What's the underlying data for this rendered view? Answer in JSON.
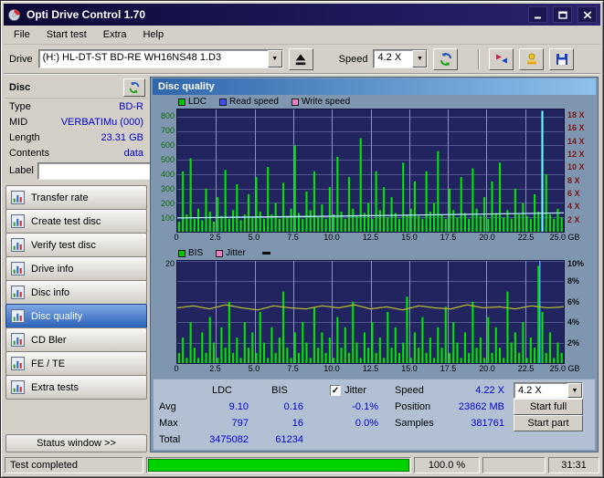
{
  "window": {
    "title": "Opti Drive Control 1.70"
  },
  "menu": {
    "items": [
      "File",
      "Start test",
      "Extra",
      "Help"
    ]
  },
  "toolbar": {
    "drive_label": "Drive",
    "drive_value": "(H:)  HL-DT-ST BD-RE  WH16NS48 1.D3",
    "speed_label": "Speed",
    "speed_value": "4.2 X"
  },
  "sidebar": {
    "header": "Disc",
    "info": [
      {
        "label": "Type",
        "value": "BD-R"
      },
      {
        "label": "MID",
        "value": "VERBATIMu (000)"
      },
      {
        "label": "Length",
        "value": "23.31 GB"
      },
      {
        "label": "Contents",
        "value": "data"
      }
    ],
    "label_field": {
      "label": "Label",
      "value": ""
    },
    "buttons": [
      {
        "label": "Transfer rate"
      },
      {
        "label": "Create test disc"
      },
      {
        "label": "Verify test disc"
      },
      {
        "label": "Drive info"
      },
      {
        "label": "Disc info"
      },
      {
        "label": "Disc quality",
        "active": true
      },
      {
        "label": "CD Bler"
      },
      {
        "label": "FE / TE"
      },
      {
        "label": "Extra tests"
      }
    ],
    "status_window_label": "Status window >>"
  },
  "panel": {
    "title": "Disc quality"
  },
  "chart_data": [
    {
      "type": "bar",
      "title": "Disc quality - LDC / Read speed",
      "legend": [
        {
          "label": "LDC",
          "color": "#00c400"
        },
        {
          "label": "Read speed",
          "color": "#3c50ff"
        },
        {
          "label": "Write speed",
          "color": "#f080c0"
        }
      ],
      "x_ticks": [
        "0",
        "2.5",
        "5.0",
        "7.5",
        "10.0",
        "12.5",
        "15.0",
        "17.5",
        "20.0",
        "22.5",
        "25.0 GB"
      ],
      "xlabel_unit": "GB",
      "y_left": {
        "ticks": [
          800,
          700,
          600,
          500,
          400,
          300,
          200,
          100
        ],
        "max": 850
      },
      "y_right": {
        "labels": [
          "18 X",
          "16 X",
          "14 X",
          "12 X",
          "10 X",
          "8 X",
          "6 X",
          "4 X",
          "2 X"
        ],
        "max": 19
      },
      "grid_h": [
        100,
        200,
        300,
        400,
        500,
        600,
        700,
        800
      ],
      "bar_color": "#00e400",
      "bars": [
        70,
        420,
        120,
        510,
        90,
        160,
        80,
        300,
        140,
        70,
        240,
        110,
        430,
        90,
        150,
        330,
        80,
        120,
        260,
        100,
        380,
        140,
        90,
        450,
        120,
        200,
        90,
        340,
        110,
        160,
        600,
        130,
        90,
        280,
        150,
        420,
        100,
        190,
        90,
        310,
        120,
        520,
        140,
        90,
        380,
        160,
        110,
        650,
        130,
        200,
        90,
        420,
        150,
        310,
        100,
        240,
        130,
        90,
        480,
        120,
        160,
        350,
        110,
        90,
        420,
        140,
        200,
        560,
        120,
        90,
        300,
        150,
        100,
        380,
        130,
        90,
        440,
        160,
        110,
        240,
        90,
        350,
        130,
        480,
        100,
        150,
        90,
        300,
        120,
        200,
        110,
        90,
        260,
        140,
        840,
        400,
        120,
        90,
        160,
        100
      ],
      "highlight": {
        "index": 94,
        "color": "#66ffff"
      },
      "line": {
        "name": "Read speed",
        "color": "#b8e8ff",
        "max": 850,
        "values": [
          96,
          99,
          102,
          105,
          108,
          112,
          115,
          119,
          123,
          127,
          131
        ]
      }
    },
    {
      "type": "bar",
      "title": "Disc quality - BIS / Jitter",
      "legend": [
        {
          "label": "BIS",
          "color": "#00c400"
        },
        {
          "label": "Jitter",
          "color": "#f080c0"
        }
      ],
      "x_ticks": [
        "0",
        "2.5",
        "5.0",
        "7.5",
        "10.0",
        "12.5",
        "15.0",
        "17.5",
        "20.0",
        "22.5",
        "25.0 GB"
      ],
      "y_left": {
        "ticks": [
          20
        ],
        "max": 20
      },
      "y_right": {
        "labels": [
          "10%",
          "8%",
          "6%",
          "4%",
          "2%"
        ],
        "max": 10
      },
      "grid_h": [
        4,
        8,
        12,
        16,
        20
      ],
      "bar_color": "#00e400",
      "bars": [
        2,
        5,
        1,
        8,
        3,
        1,
        6,
        2,
        9,
        4,
        1,
        7,
        3,
        12,
        2,
        5,
        1,
        8,
        3,
        6,
        2,
        10,
        4,
        1,
        7,
        2,
        5,
        14,
        3,
        1,
        6,
        2,
        8,
        4,
        1,
        11,
        3,
        6,
        2,
        5,
        1,
        9,
        3,
        7,
        2,
        12,
        4,
        1,
        6,
        3,
        8,
        2,
        5,
        1,
        10,
        3,
        7,
        2,
        4,
        13,
        1,
        6,
        3,
        9,
        2,
        5,
        1,
        7,
        3,
        11,
        2,
        8,
        4,
        1,
        6,
        2,
        12,
        3,
        5,
        1,
        9,
        2,
        7,
        3,
        1,
        14,
        4,
        6,
        2,
        8,
        1,
        5,
        3,
        19,
        10,
        2,
        6,
        1,
        4,
        2
      ],
      "vline": {
        "frac": 0.938,
        "color": "#4aa0ff"
      },
      "line": {
        "name": "Jitter",
        "color": "#b8b835",
        "max": 10,
        "values": [
          5.4,
          5.6,
          5.3,
          5.7,
          5.4,
          5.2,
          5.6,
          5.4,
          5.3,
          5.6,
          5.4,
          5.7,
          5.3,
          5.5,
          5.2,
          5.6,
          5.4,
          5.3,
          5.7,
          5.4,
          5.5,
          5.3,
          5.6,
          5.4,
          5.5
        ]
      }
    }
  ],
  "summary": {
    "col_ldc": "LDC",
    "col_bis": "BIS",
    "jitter_label": "Jitter",
    "jitter_checked": true,
    "rows": [
      {
        "label": "Avg",
        "ldc": "9.10",
        "bis": "0.16",
        "jitter": "-0.1%"
      },
      {
        "label": "Max",
        "ldc": "797",
        "bis": "16",
        "jitter": "0.0%"
      },
      {
        "label": "Total",
        "ldc": "3475082",
        "bis": "61234",
        "jitter": ""
      }
    ],
    "speed_label": "Speed",
    "speed_value": "4.22 X",
    "speed_combo": "4.2 X",
    "position_label": "Position",
    "position_value": "23862 MB",
    "start_full": "Start full",
    "samples_label": "Samples",
    "samples_value": "381761",
    "start_part": "Start part"
  },
  "statusbar": {
    "text": "Test completed",
    "percent": "100.0 %",
    "time": "31:31",
    "progress_value": 100
  },
  "colors": {
    "titlebar": "#140f3f",
    "active_button": "#2b62b8",
    "value_text": "#0000cd",
    "plot_bg": "#21245e",
    "bar_green": "#00e400",
    "read_speed_line": "#b8e8ff",
    "jitter_line": "#b8b835",
    "progress_green": "#00d400"
  }
}
